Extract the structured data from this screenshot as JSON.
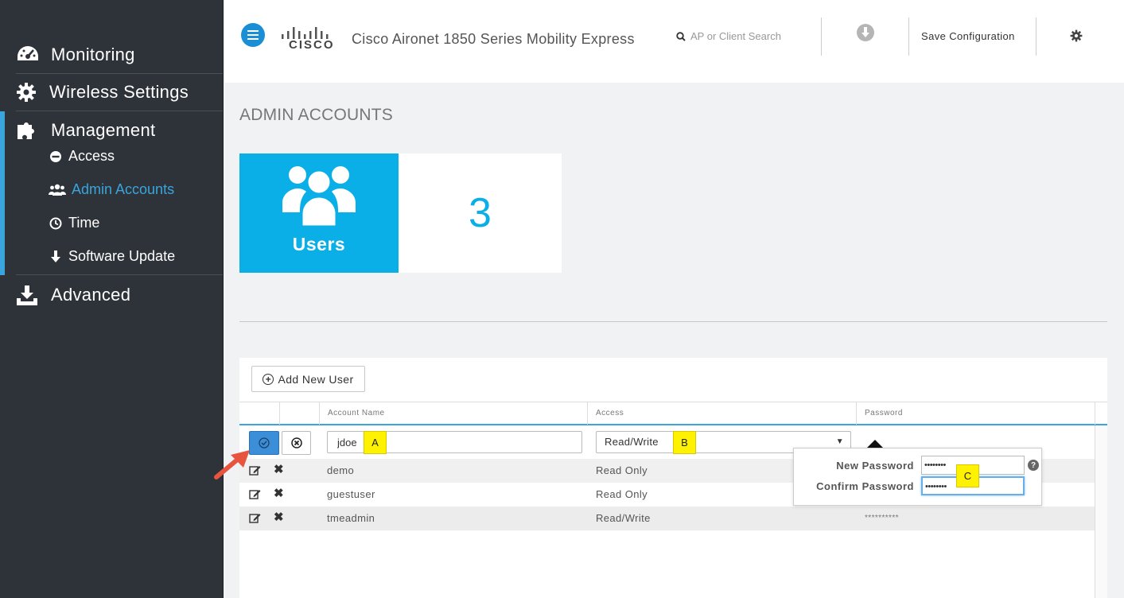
{
  "sidebar": {
    "items": [
      {
        "label": "Monitoring",
        "icon": "speedometer-icon"
      },
      {
        "label": "Wireless Settings",
        "icon": "gear-icon"
      },
      {
        "label": "Management",
        "icon": "puzzle-icon"
      },
      {
        "label": "Advanced",
        "icon": "download-tray-icon"
      }
    ],
    "management_sub": [
      {
        "label": "Access",
        "icon": "minus-circle-icon"
      },
      {
        "label": "Admin Accounts",
        "icon": "users-icon",
        "active": true
      },
      {
        "label": "Time",
        "icon": "clock-icon"
      },
      {
        "label": "Software Update",
        "icon": "arrow-down-icon"
      }
    ]
  },
  "header": {
    "logo_text": "CISCO",
    "title": "Cisco Aironet 1850 Series Mobility Express",
    "search_placeholder": "AP or Client Search",
    "save_label": "Save Configuration"
  },
  "main": {
    "page_title": "ADMIN ACCOUNTS",
    "tile_label": "Users",
    "tile_count": "3",
    "add_user_label": "Add New User",
    "columns": [
      "Account Name",
      "Access",
      "Password"
    ],
    "edit_row": {
      "name": "jdoe",
      "access": "Read/Write",
      "callout_name": "A",
      "callout_access": "B",
      "callout_password": "C"
    },
    "rows": [
      {
        "name": "demo",
        "access": "Read Only",
        "password": ""
      },
      {
        "name": "guestuser",
        "access": "Read Only",
        "password": ""
      },
      {
        "name": "tmeadmin",
        "access": "Read/Write",
        "password": "**********"
      }
    ],
    "password_popup": {
      "new_label": "New Password",
      "confirm_label": "Confirm Password",
      "new_value": "••••••••",
      "confirm_value": "••••••••"
    }
  },
  "colors": {
    "accent": "#3aa5dc",
    "tile": "#0aafe8",
    "sidebar_bg": "#2e3239",
    "callout": "#fff200"
  }
}
